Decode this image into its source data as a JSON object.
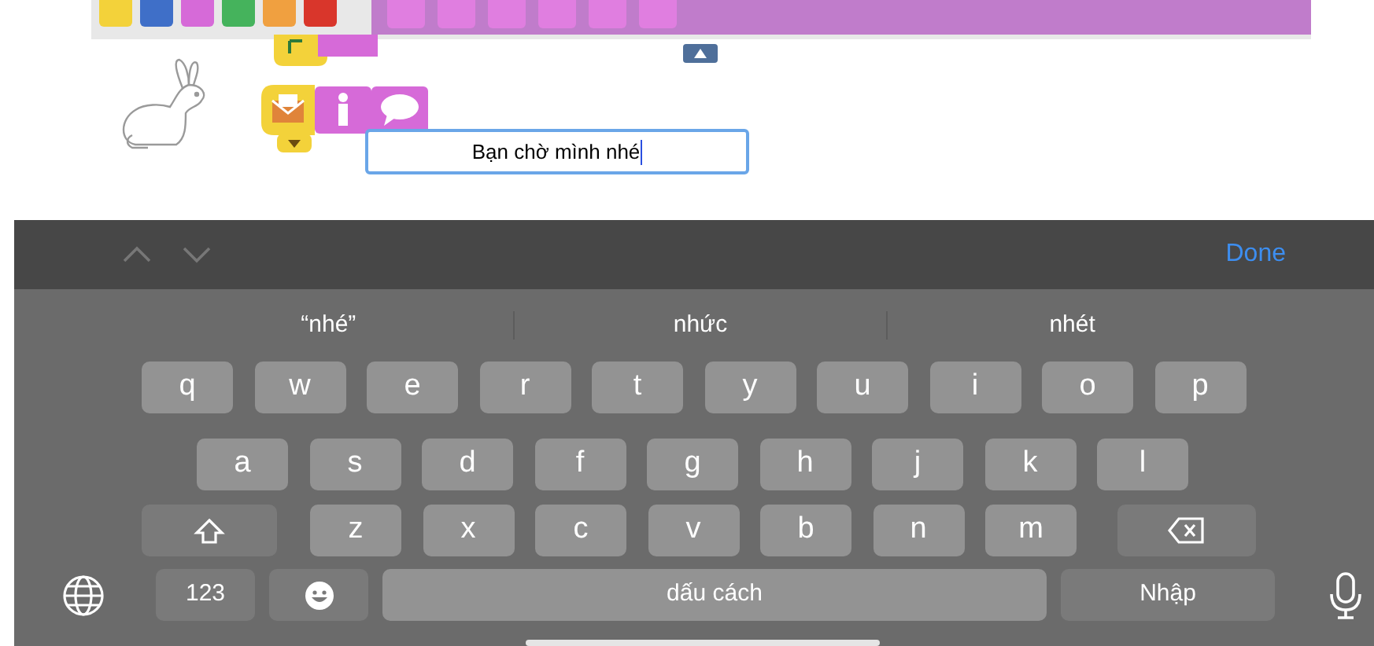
{
  "speech_field": {
    "value": "Bạn chờ mình nhé"
  },
  "toolbar": {
    "done": "Done"
  },
  "suggestions": [
    {
      "text": "“nhé”"
    },
    {
      "text": "nhức"
    },
    {
      "text": "nhét"
    }
  ],
  "letter_rows": [
    [
      "q",
      "w",
      "e",
      "r",
      "t",
      "y",
      "u",
      "i",
      "o",
      "p"
    ],
    [
      "a",
      "s",
      "d",
      "f",
      "g",
      "h",
      "j",
      "k",
      "l"
    ],
    [
      "z",
      "x",
      "c",
      "v",
      "b",
      "n",
      "m"
    ]
  ],
  "bottom_row": [
    {
      "kind": "globe"
    },
    {
      "kind": "text",
      "label": "123"
    },
    {
      "kind": "emoji"
    },
    {
      "kind": "space",
      "label": "dấu cách"
    },
    {
      "kind": "return",
      "label": "Nhập"
    },
    {
      "kind": "mic"
    }
  ]
}
